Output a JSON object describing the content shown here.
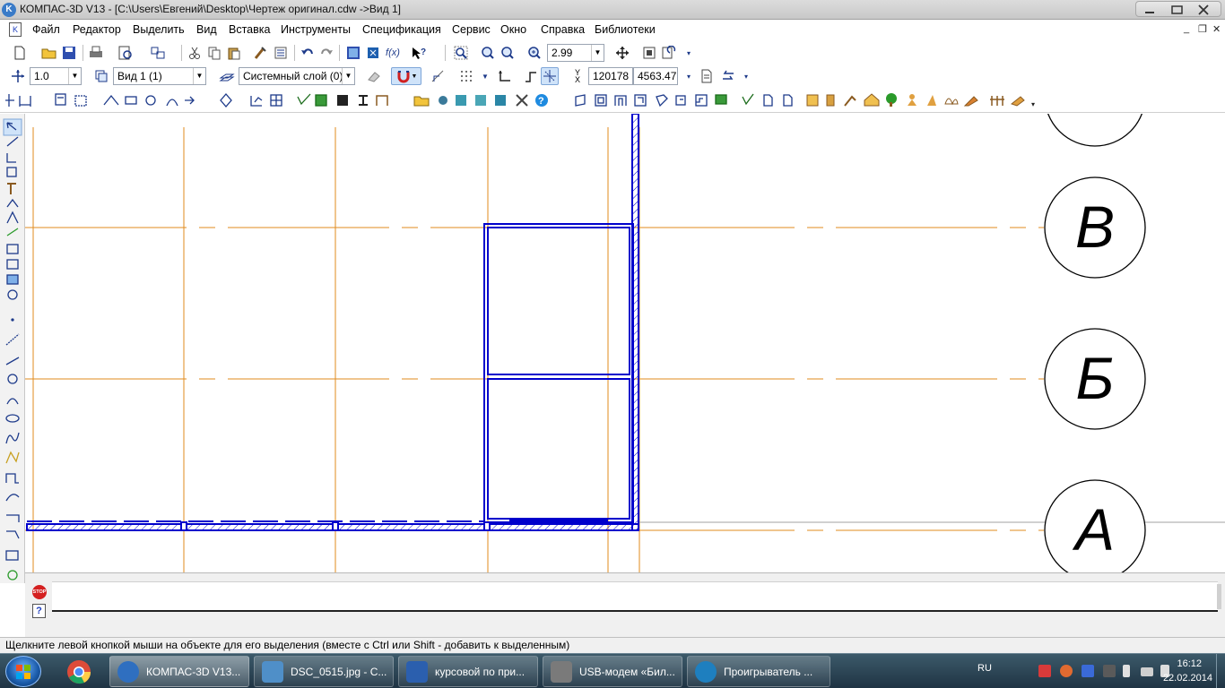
{
  "window": {
    "title": "КОМПАС-3D V13 - [C:\\Users\\Евгений\\Desktop\\Чертеж оригинал.cdw ->Вид 1]",
    "app_icon_letter": "K"
  },
  "menu": {
    "doc_icon_letter": "K",
    "items": [
      "Файл",
      "Редактор",
      "Выделить",
      "Вид",
      "Вставка",
      "Инструменты",
      "Спецификация",
      "Сервис",
      "Окно",
      "Справка",
      "Библиотеки"
    ],
    "mdi_minimize": "_",
    "mdi_restore": "❐",
    "mdi_close": "✕"
  },
  "toolbar_standard": {
    "zoom_value": "2.99",
    "fx_label": "f(x)"
  },
  "toolbar_props": {
    "scale_value": "1.0",
    "view_value": "Вид 1 (1)",
    "layer_value": "Системный слой (0)",
    "coord_x": "120178",
    "coord_y": "4563.47",
    "y_label": "Y",
    "x_label": "X"
  },
  "drawing": {
    "axis_labels": [
      "В",
      "Б",
      "А"
    ],
    "colors": {
      "axis": "#e08b1e",
      "wall": "#0000cc",
      "bubble": "#000000",
      "bg": "#ffffff"
    }
  },
  "command_panel": {
    "stop_label": "STOP",
    "help_label": "?"
  },
  "status": {
    "hint": "Щелкните левой кнопкой мыши на объекте для его выделения (вместе с Ctrl или Shift - добавить к выделенным)"
  },
  "taskbar": {
    "apps": [
      {
        "label": "КОМПАС-3D V13...",
        "active": true,
        "color": "#2f6fc0"
      },
      {
        "label": "DSC_0515.jpg - С...",
        "active": false,
        "color": "#4f8fc8"
      },
      {
        "label": "курсовой по при...",
        "active": false,
        "color": "#2b5fae"
      },
      {
        "label": "USB-модем «Бил...",
        "active": false,
        "color": "#7a7a7a"
      },
      {
        "label": "Проигрыватель ...",
        "active": false,
        "color": "#1e7fbf"
      }
    ],
    "lang": "RU",
    "time": "16:12",
    "date": "22.02.2014"
  }
}
